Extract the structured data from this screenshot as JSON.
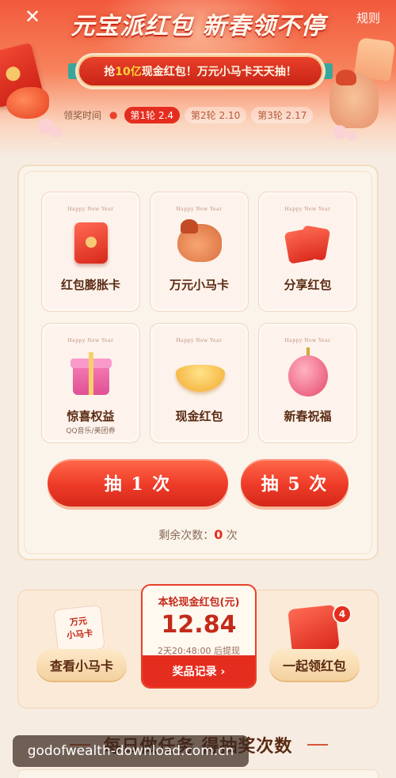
{
  "header": {
    "close_icon": "close-icon",
    "rules_label": "规则",
    "title": "元宝派红包 新春领不停",
    "promo_prefix": "抢",
    "promo_highlight": "10亿",
    "promo_suffix": "现金红包！万元小马卡天天抽！",
    "round_label": "领奖时间",
    "rounds": [
      {
        "label": "第1轮 2.4",
        "active": true
      },
      {
        "label": "第2轮 2.10",
        "active": false
      },
      {
        "label": "第3轮 2.17",
        "active": false
      }
    ]
  },
  "prizes": [
    {
      "hny": "Happy New Year",
      "name": "红包膨胀卡",
      "sub": "",
      "icon": "red-envelope-icon"
    },
    {
      "hny": "Happy New Year",
      "name": "万元小马卡",
      "sub": "",
      "icon": "horse-icon"
    },
    {
      "hny": "Happy New Year",
      "name": "分享红包",
      "sub": "",
      "icon": "share-envelope-icon"
    },
    {
      "hny": "Happy New Year",
      "name": "惊喜权益",
      "sub": "QQ音乐/美团券",
      "icon": "gift-box-icon"
    },
    {
      "hny": "Happy New Year",
      "name": "现金红包",
      "sub": "",
      "icon": "gold-ingot-icon"
    },
    {
      "hny": "Happy New Year",
      "name": "新春祝福",
      "sub": "",
      "icon": "lantern-icon"
    }
  ],
  "draw": {
    "once_label": "抽 1 次",
    "five_label": "抽 5 次",
    "remain_prefix": "剩余次数：",
    "remain_count": "0",
    "remain_suffix": " 次"
  },
  "wallet": {
    "title": "本轮现金红包(元)",
    "amount": "12.84",
    "time_note": "2天20:48:00 后提现",
    "records_label": "奖品记录 ›"
  },
  "mini": {
    "horse_card_text": "万元\n小马卡",
    "badge_count": "4"
  },
  "buttons": {
    "view_horse": "查看小马卡",
    "claim_together": "一起领红包"
  },
  "task_title": "每日做任务 得抽奖次数",
  "watermark": "godofwealth-download.com.cn",
  "colors": {
    "accent": "#e52d1f",
    "header_top": "#f25a3c",
    "page_bg": "#f6ece2"
  }
}
